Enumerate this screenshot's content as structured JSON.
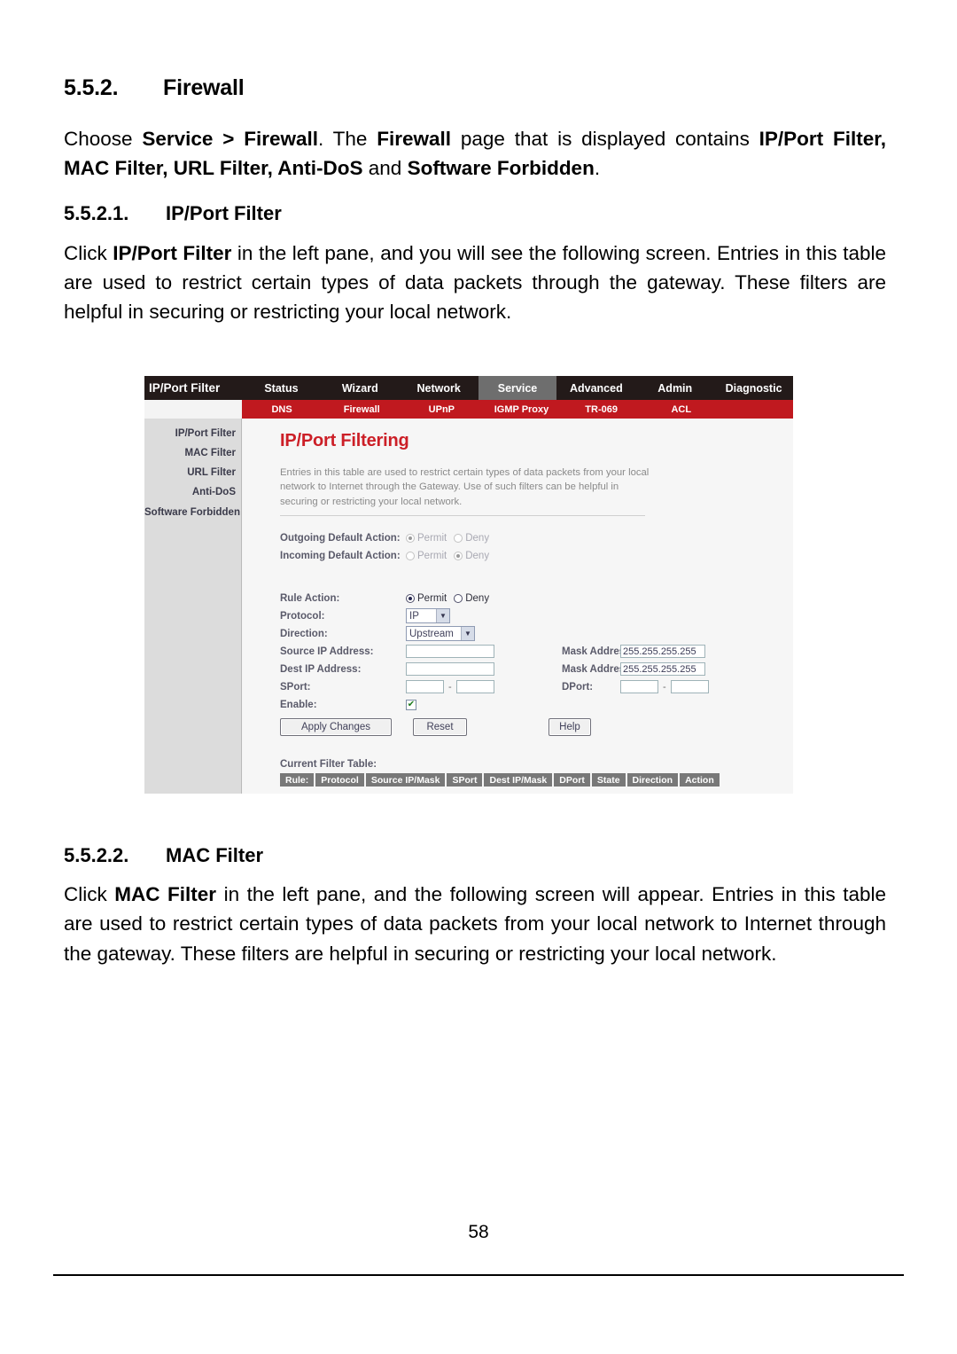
{
  "document": {
    "section": {
      "number": "5.5.2.",
      "title": "Firewall"
    },
    "intro_paragraph": {
      "t1": "Choose ",
      "b1": "Service > Firewall",
      "t2": ". The ",
      "b2": "Firewall",
      "t3": " page that is displayed contains ",
      "b3": "IP/Port Filter, MAC Filter, URL Filter, Anti-DoS",
      "t4": " and ",
      "b4": "Software Forbidden",
      "t5": "."
    },
    "subsection_1": {
      "number": "5.5.2.1.",
      "title": "IP/Port Filter",
      "paragraph": {
        "t1": "Click ",
        "b1": "IP/Port Filter",
        "t2": " in the left pane, and you will see the following screen. Entries in this table are used to restrict certain types of data packets through the gateway. These filters are helpful in securing or restricting your local network."
      }
    },
    "subsection_2": {
      "number": "5.5.2.2.",
      "title": "MAC Filter",
      "paragraph": {
        "t1": "Click ",
        "b1": "MAC Filter",
        "t2": " in the left pane, and the following screen will appear. Entries in this table are used to restrict certain types of data packets from your local network to Internet through the gateway. These filters are helpful in securing or restricting your local network."
      }
    },
    "page_number": "58"
  },
  "screenshot": {
    "brand": "IP/Port Filter",
    "nav_tabs": [
      {
        "label": "Status",
        "active": false
      },
      {
        "label": "Wizard",
        "active": false
      },
      {
        "label": "Network",
        "active": false
      },
      {
        "label": "Service",
        "active": true
      },
      {
        "label": "Advanced",
        "active": false
      },
      {
        "label": "Admin",
        "active": false
      },
      {
        "label": "Diagnostic",
        "active": false
      }
    ],
    "sub_tabs": [
      {
        "label": "DNS"
      },
      {
        "label": "Firewall"
      },
      {
        "label": "UPnP"
      },
      {
        "label": "IGMP Proxy"
      },
      {
        "label": "TR-069"
      },
      {
        "label": "ACL"
      }
    ],
    "sidebar": [
      {
        "label": "IP/Port Filter"
      },
      {
        "label": "MAC Filter"
      },
      {
        "label": "URL Filter"
      },
      {
        "label": "Anti-DoS"
      },
      {
        "label": "Software Forbidden"
      }
    ],
    "panel": {
      "title": "IP/Port Filtering",
      "description": "Entries in this table are used to restrict certain types of data packets from your local network to Internet through the Gateway. Use of such filters can be helpful in securing or restricting your local network."
    },
    "defaults": {
      "outgoing_label": "Outgoing Default Action:",
      "outgoing_permit": "Permit",
      "outgoing_deny": "Deny",
      "outgoing_selected": "Permit",
      "incoming_label": "Incoming Default Action:",
      "incoming_permit": "Permit",
      "incoming_deny": "Deny",
      "incoming_selected": "Deny"
    },
    "rule": {
      "action_label": "Rule Action:",
      "action_permit": "Permit",
      "action_deny": "Deny",
      "action_selected": "Permit",
      "protocol_label": "Protocol:",
      "protocol_value": "IP",
      "direction_label": "Direction:",
      "direction_value": "Upstream",
      "source_ip_label": "Source IP Address:",
      "source_ip_value": "",
      "source_mask_label": "Mask Address:",
      "source_mask_value": "255.255.255.255",
      "dest_ip_label": "Dest IP Address:",
      "dest_ip_value": "",
      "dest_mask_label": "Mask Address:",
      "dest_mask_value": "255.255.255.255",
      "sport_label": "SPort:",
      "sport_from": "",
      "sport_to": "",
      "dport_label": "DPort:",
      "dport_from": "",
      "dport_to": "",
      "enable_label": "Enable:",
      "enable_checked": true,
      "check_glyph": "✔"
    },
    "buttons": {
      "apply": "Apply Changes",
      "reset": "Reset",
      "help": "Help"
    },
    "filter_table": {
      "label": "Current Filter Table:",
      "columns": [
        "Rule:",
        "Protocol",
        "Source IP/Mask",
        "SPort",
        "Dest IP/Mask",
        "DPort",
        "State",
        "Direction",
        "Action"
      ],
      "rows": []
    },
    "colors": {
      "nav_bg": "#231a19",
      "nav_active": "#6e6e6e",
      "subnav_bg": "#c0191f",
      "panel_title": "#cc1f27",
      "sidebar_bg": "#dcdcdc",
      "table_header": "#787878"
    },
    "icons": {
      "dropdown_arrow": "▼"
    }
  }
}
